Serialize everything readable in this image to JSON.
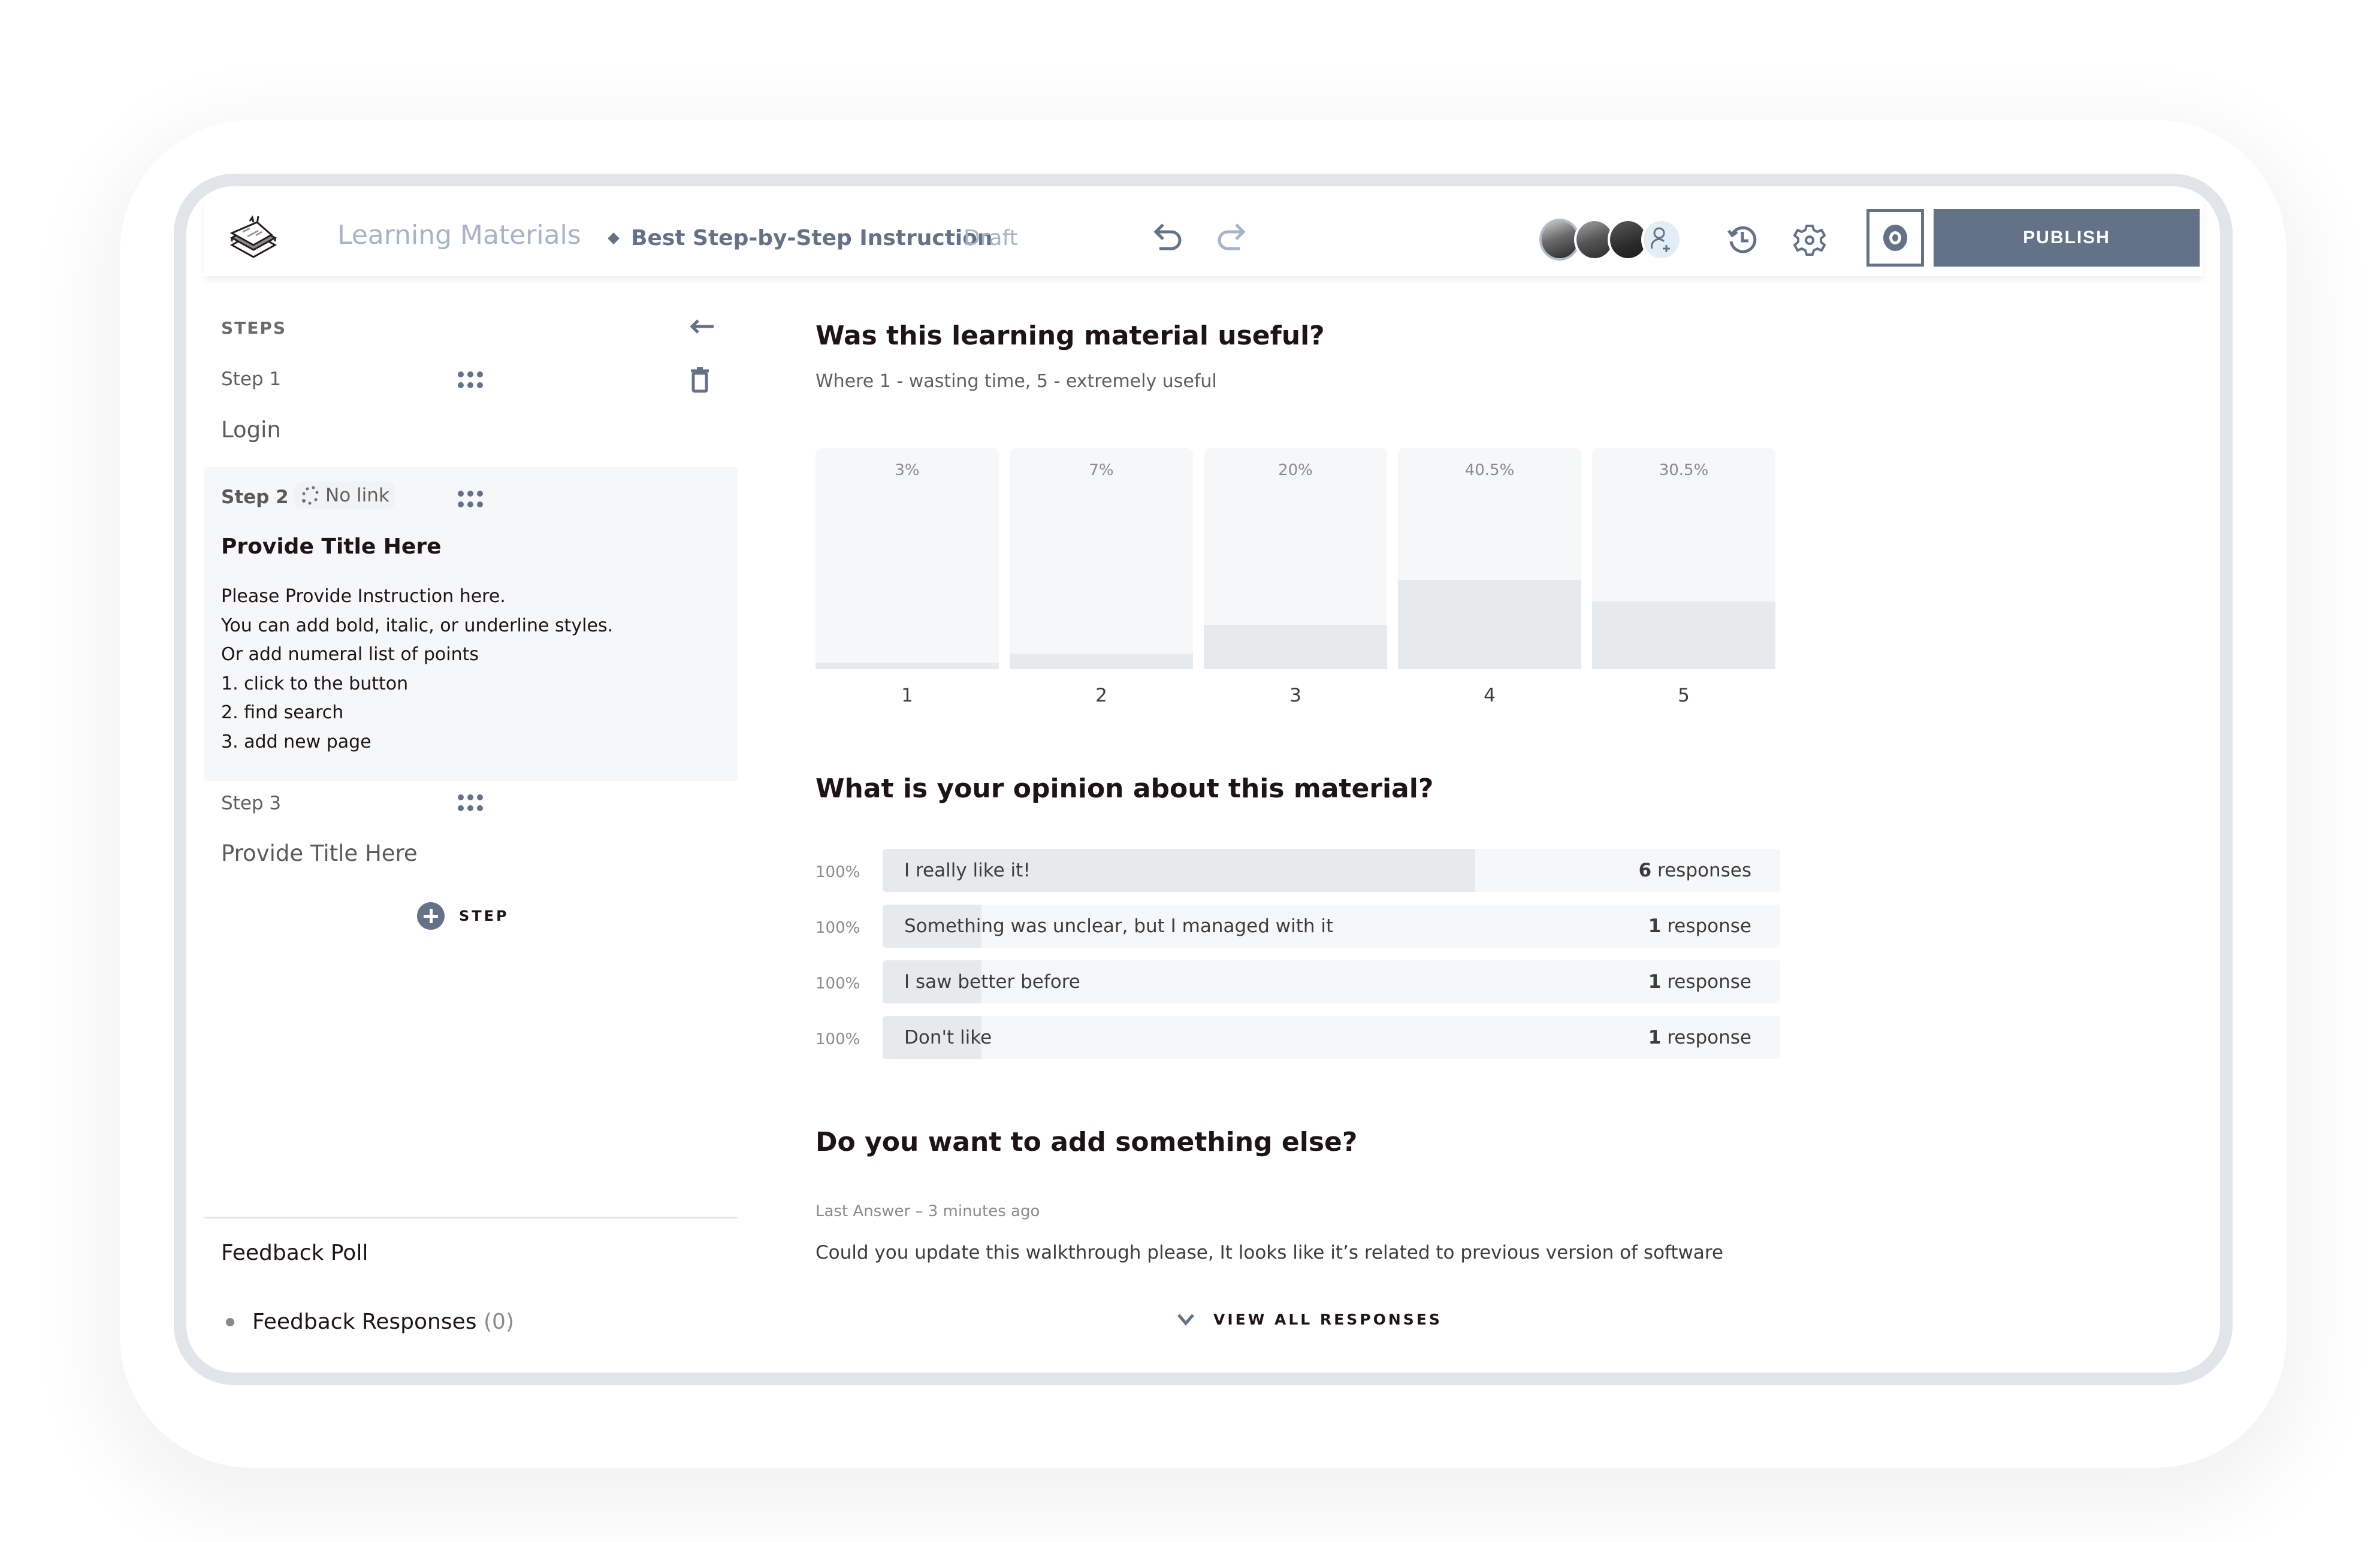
{
  "header": {
    "app_title": "Learning Materials",
    "doc_title": "Best Step-by-Step Instruction",
    "doc_status": "Draft",
    "icons": {
      "logo": "stacked-books-logo",
      "undo": "undo-icon",
      "redo": "redo-icon",
      "add_user": "add-user-icon",
      "history": "history-icon",
      "settings": "gear-icon",
      "preview": "eye-icon"
    },
    "collaborators": [
      "collaborator-1",
      "collaborator-2",
      "collaborator-3"
    ],
    "publish_label": "PUBLISH",
    "accent_color": "#647287"
  },
  "sidebar": {
    "heading": "STEPS",
    "steps": [
      {
        "label": "Step 1",
        "title": "Login"
      },
      {
        "label": "Step 2",
        "link_status": "No link",
        "title": "Provide Title Here",
        "instructions": [
          "Please Provide Instruction here.",
          "You can add bold, italic, or underline styles.",
          "Or add numeral list of points",
          "1. click to the button",
          "2. find search",
          "3. add new page"
        ]
      },
      {
        "label": "Step 3",
        "title": "Provide Title Here"
      }
    ],
    "add_step_label": "STEP",
    "feedback_poll_title": "Feedback Poll",
    "feedback_responses_label": "Feedback Responses",
    "feedback_responses_count": "(0)"
  },
  "main": {
    "q1": {
      "title": "Was this learning material useful?",
      "subtitle": "Where 1 - wasting time, 5 - extremely useful"
    },
    "q2": {
      "title": "What is your opinion about this material?",
      "options": [
        {
          "pct": "100%",
          "label": "I really like it!",
          "count": "6",
          "unit": "responses",
          "fill": 0.66
        },
        {
          "pct": "100%",
          "label": "Something was unclear, but I managed with it",
          "count": "1",
          "unit": "response",
          "fill": 0.11
        },
        {
          "pct": "100%",
          "label": "I saw better before",
          "count": "1",
          "unit": "response",
          "fill": 0.11
        },
        {
          "pct": "100%",
          "label": "Don't like",
          "count": "1",
          "unit": "response",
          "fill": 0.11
        }
      ]
    },
    "q3": {
      "title": "Do you want to add something else?",
      "last_answer": "Last Answer – 3 minutes ago",
      "answer": "Could you update this walkthrough please, It looks like it’s related to previous version of software",
      "view_all_label": "VIEW ALL RESPONSES"
    }
  },
  "chart_data": {
    "type": "bar",
    "title": "Was this learning material useful?",
    "subtitle": "Where 1 - wasting time, 5 - extremely useful",
    "categories": [
      "1",
      "2",
      "3",
      "4",
      "5"
    ],
    "values": [
      3,
      7,
      20,
      40.5,
      30.5
    ],
    "value_labels": [
      "3%",
      "7%",
      "20%",
      "40.5%",
      "30.5%"
    ],
    "xlabel": "",
    "ylabel": "",
    "ylim": [
      0,
      100
    ],
    "grid": false
  }
}
